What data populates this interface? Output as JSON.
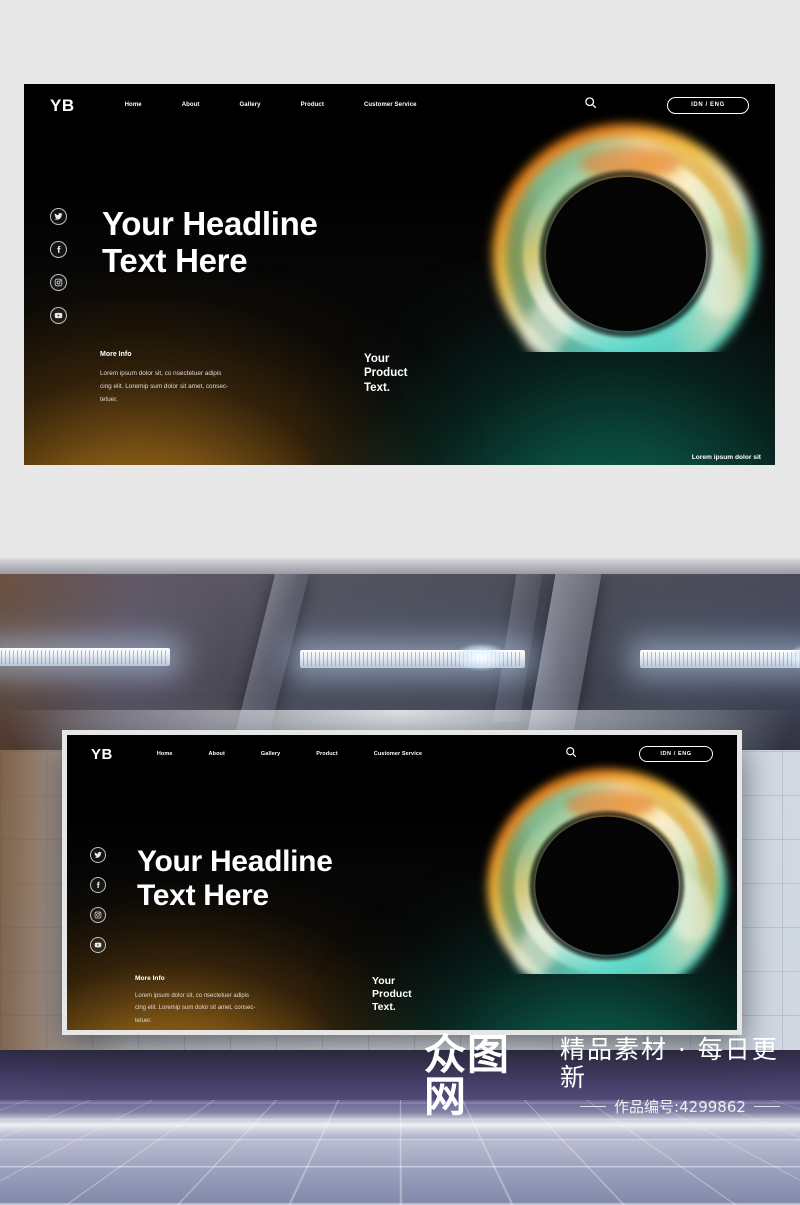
{
  "page": {
    "background_color": "#e8e8e8"
  },
  "banner": {
    "background_color": "#070707",
    "accent_warm": "#d69628",
    "accent_teal": "#108068",
    "nav": {
      "logo": "YB",
      "links": [
        {
          "label": "Home"
        },
        {
          "label": "About"
        },
        {
          "label": "Gallery"
        },
        {
          "label": "Product"
        },
        {
          "label": "Customer Service"
        }
      ],
      "search_icon": "search-icon",
      "language_toggle": "IDN / ENG"
    },
    "socials": [
      {
        "name": "twitter-icon"
      },
      {
        "name": "facebook-icon"
      },
      {
        "name": "instagram-icon"
      },
      {
        "name": "youtube-icon"
      }
    ],
    "headline_line1": "Your Headline",
    "headline_line2": "Text Here",
    "more_info": {
      "title": "More Info",
      "line1": "Lorem ipsum dolor sit, co nsectetuer adipis",
      "line2": "cing elit. Loremip sum dolor sit amet, consec-",
      "line3": "tetuer."
    },
    "product_text": {
      "line1": "Your",
      "line2": "Product",
      "line3": "Text."
    },
    "corner_caption": "Lorem ipsum dolor sit",
    "ring": {
      "name": "gradient-ring-graphic",
      "colors": {
        "orange": "#e8821f",
        "amber": "#f2b43c",
        "gold": "#e9c25a",
        "cream": "#f4efd8",
        "mint": "#9fe0cc",
        "teal": "#4fd6c4",
        "cyan": "#58d9cf",
        "deep_green": "#1f6f5c"
      }
    }
  },
  "watermark": {
    "logo": "众图网",
    "tagline": "精品素材 · 每日更新",
    "id_label": "作品编号:4299862"
  }
}
